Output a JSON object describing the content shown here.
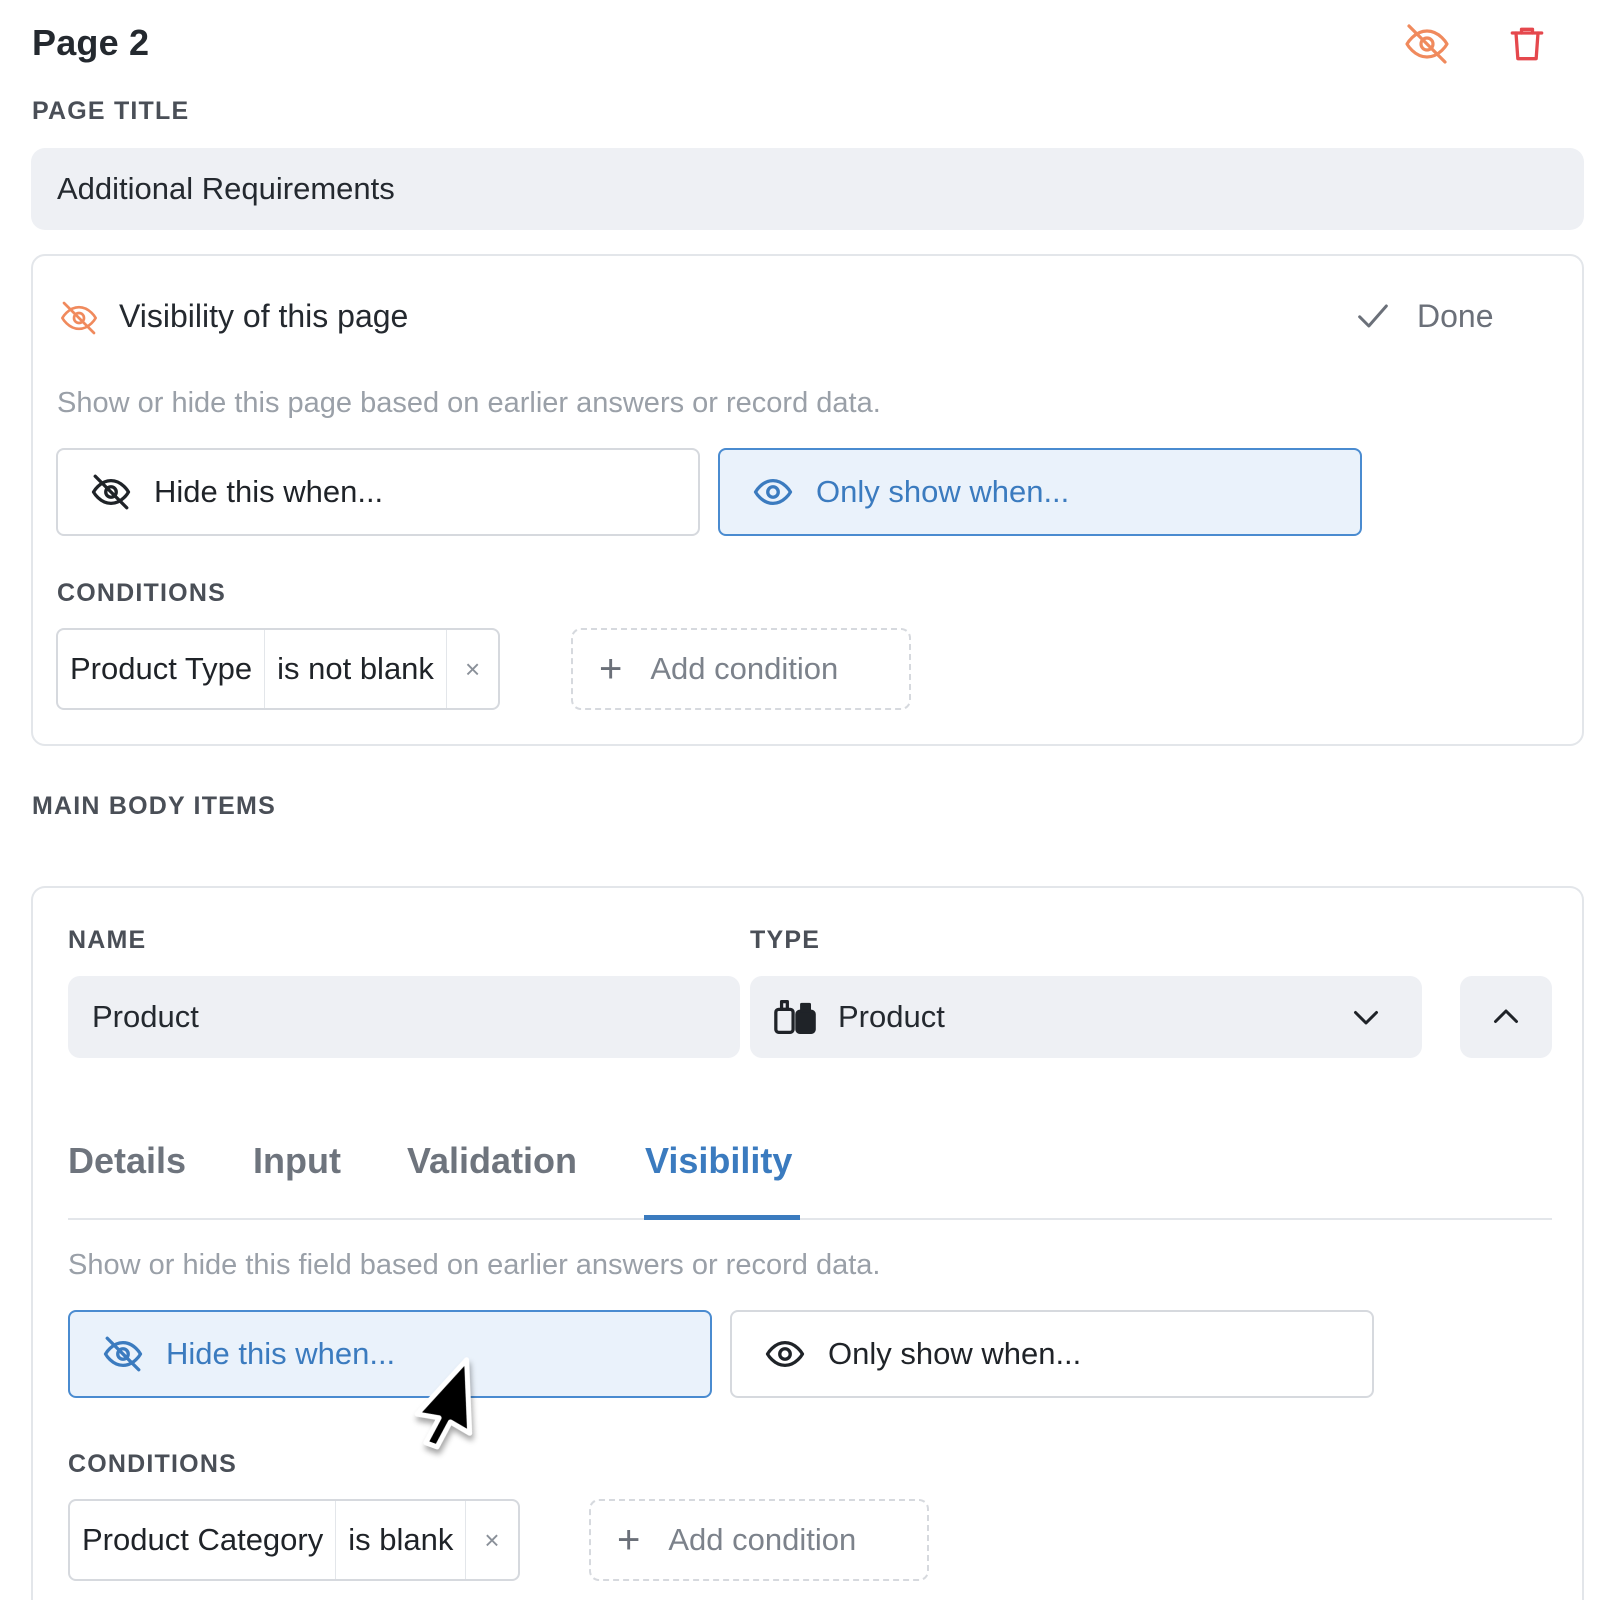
{
  "header": {
    "page_name": "Page 2",
    "hide_icon": "eye-off-icon",
    "delete_icon": "trash-icon",
    "accent_orange": "#f08a5d",
    "delete_red": "#e5484d"
  },
  "page_title": {
    "label": "PAGE TITLE",
    "value": "Additional Requirements"
  },
  "page_visibility": {
    "title": "Visibility of this page",
    "done_label": "Done",
    "helper": "Show or hide this page based on earlier answers or record data.",
    "modes": [
      {
        "label": "Hide this when...",
        "icon": "eye-off-icon",
        "active": false
      },
      {
        "label": "Only show when...",
        "icon": "eye-icon",
        "active": true
      }
    ],
    "conditions_label": "CONDITIONS",
    "conditions": [
      {
        "field": "Product Type",
        "operator": "is not blank",
        "remove": "×"
      }
    ],
    "add_condition_label": "Add condition"
  },
  "main_body": {
    "label": "MAIN BODY ITEMS",
    "item": {
      "name_label": "NAME",
      "name_value": "Product",
      "type_label": "TYPE",
      "type_value": "Product",
      "type_icon": "product-icon",
      "tabs": [
        {
          "label": "Details",
          "active": false
        },
        {
          "label": "Input",
          "active": false
        },
        {
          "label": "Validation",
          "active": false
        },
        {
          "label": "Visibility",
          "active": true
        }
      ],
      "helper": "Show or hide this field based on earlier answers or record data.",
      "modes": [
        {
          "label": "Hide this when...",
          "icon": "eye-off-icon",
          "active": true
        },
        {
          "label": "Only show when...",
          "icon": "eye-icon",
          "active": false
        }
      ],
      "conditions_label": "CONDITIONS",
      "conditions": [
        {
          "field": "Product Category",
          "operator": "is blank",
          "remove": "×"
        }
      ],
      "add_condition_label": "Add condition"
    }
  }
}
